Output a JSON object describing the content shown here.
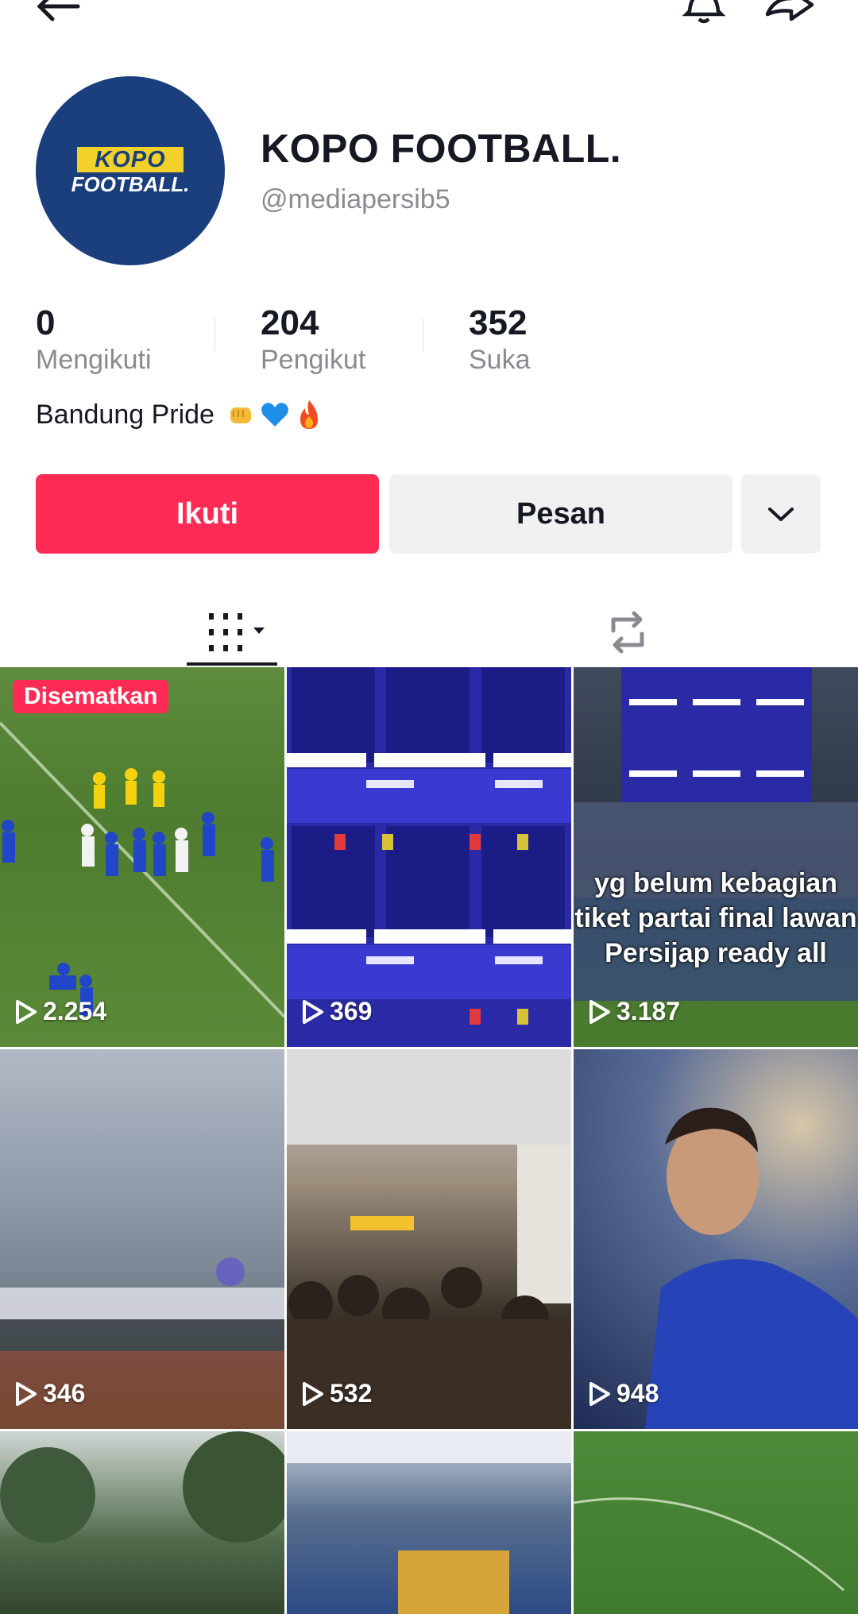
{
  "profile": {
    "avatar_line1": "KOPO",
    "avatar_line2": "FOOTBALL.",
    "name": "KOPO FOOTBALL.",
    "handle": "@mediapersib5",
    "bio": "Bandung Pride"
  },
  "stats": [
    {
      "value": "0",
      "label": "Mengikuti"
    },
    {
      "value": "204",
      "label": "Pengikut"
    },
    {
      "value": "352",
      "label": "Suka"
    }
  ],
  "actions": {
    "follow_label": "Ikuti",
    "message_label": "Pesan"
  },
  "grid": {
    "pinned_label": "Disematkan",
    "tiles": [
      {
        "views": "2.254"
      },
      {
        "views": "369"
      },
      {
        "views": "3.187",
        "overlay": "yg belum kebagian tiket partai final lawan Persijap ready all"
      },
      {
        "views": "346"
      },
      {
        "views": "532"
      },
      {
        "views": "948"
      }
    ]
  },
  "colors": {
    "accent": "#fe2c55",
    "avatar_bg": "#1b3f7d",
    "avatar_logo": "#f2d12b"
  },
  "icons": [
    "back-arrow-icon",
    "bell-icon",
    "share-icon",
    "grid-icon",
    "repost-icon",
    "chevron-down-icon",
    "play-icon"
  ]
}
